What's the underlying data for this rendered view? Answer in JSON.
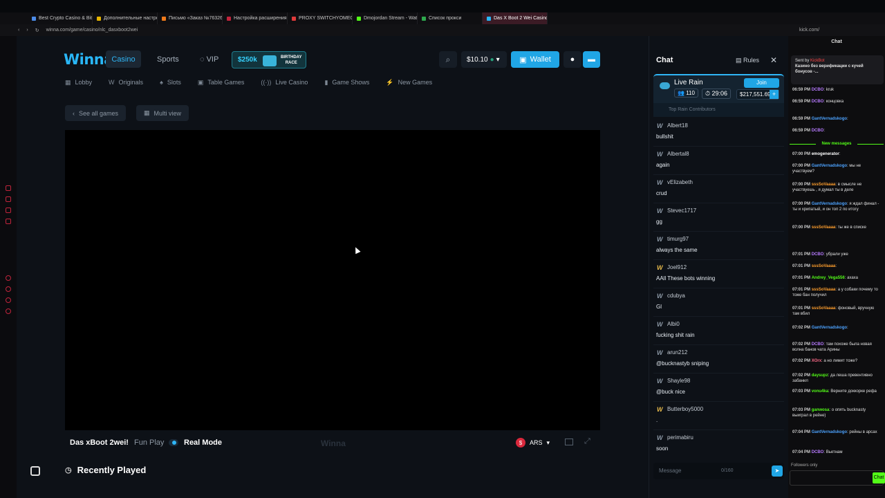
{
  "browser": {
    "tabs": [
      {
        "label": "Best Crypto Casino & Bitco",
        "color": "#4b8be8"
      },
      {
        "label": "Дополнительные настро",
        "color": "#e5b400"
      },
      {
        "label": "Письмо «Заказ №76326»",
        "color": "#f07a1a"
      },
      {
        "label": "Настройка расширения",
        "color": "#c2243c"
      },
      {
        "label": "PROXY SWITCHYOMEGA",
        "color": "#e03a3a"
      },
      {
        "label": "Dmojordan Stream - Watc",
        "color": "#53fc18"
      },
      {
        "label": "Список прокси",
        "color": "#2ea84d"
      },
      {
        "label": "Das X Boot 2 Wei Casino",
        "color": "#29b6f6",
        "active": true
      }
    ],
    "url": "winna.com/game/casino/nlc_dasxboot2wei",
    "url2": "kick.com/"
  },
  "site": {
    "logo": "Winna",
    "nav": {
      "casino": "Casino",
      "sports": "Sports",
      "vip": "VIP"
    },
    "race": {
      "amount": "$250k",
      "label_line1": "BIRTHDAY",
      "label_line2": "RACE"
    },
    "balance": "$10.10",
    "wallet": "Wallet",
    "subnav": [
      "Lobby",
      "Originals",
      "Slots",
      "Table Games",
      "Live Casino",
      "Game Shows",
      "New Games"
    ],
    "see_all": "See all games",
    "multi_view": "Multi view",
    "game_title": "Das xBoot 2wei!",
    "fun_play": "Fun Play",
    "real_mode": "Real Mode",
    "watermark": "Winna",
    "currency": "ARS",
    "recently_played": "Recently Played"
  },
  "chat": {
    "title": "Chat",
    "rules": "Rules",
    "rain": {
      "title": "Live Rain",
      "join": "Join",
      "users": "110",
      "timer": "29:06",
      "pot": "$217,551.69"
    },
    "contributors": "Top Rain Contributors",
    "messages": [
      {
        "user": "Albert18",
        "text": "bullshit"
      },
      {
        "user": "Albertal8",
        "text": "again"
      },
      {
        "user": "vElizabeth",
        "text": "crud"
      },
      {
        "user": "Stevec1717",
        "text": "gg"
      },
      {
        "user": "timurg97",
        "text": "always the same"
      },
      {
        "user": "Joel912",
        "text": "AAll These bots winning"
      },
      {
        "user": "cdubya",
        "text": "Gl"
      },
      {
        "user": "Albi0",
        "text": "fucking shit rain"
      },
      {
        "user": "arun212",
        "text": "@bucknastyb sniping"
      },
      {
        "user": "Shayle98",
        "text": "@buck nice"
      },
      {
        "user": "Butterboy5000",
        "text": "."
      },
      {
        "user": "perimabiru",
        "text": "soon"
      }
    ],
    "input_placeholder": "Message",
    "count": "0/160"
  },
  "kick": {
    "title": "Chat",
    "pinned_by": "Sent by",
    "pinned_name": "KickBot",
    "pinned_text": "Казино без верификации с кучей бонусов -...",
    "new_messages": "New messages",
    "followers": "Followers only",
    "chat_btn": "Chat",
    "lines": [
      {
        "time": "06:59 PM",
        "name": "DCBO",
        "color": "#b77bff",
        "text": "kruk"
      },
      {
        "time": "06:59 PM",
        "name": "DCBO",
        "color": "#b77bff",
        "text": "концовка"
      },
      {
        "time": "06:59 PM",
        "name": "GantVernadskogo",
        "color": "#4da3ff",
        "text": ""
      },
      {
        "time": "06:59 PM",
        "name": "DCBO",
        "color": "#b77bff",
        "text": ""
      },
      {
        "time": "07:00 PM",
        "name": "emogenerator",
        "color": "#ffffff",
        "text": ""
      },
      {
        "time": "07:00 PM",
        "name": "GantVernadskogo",
        "color": "#4da3ff",
        "text": "мы не участвуем?"
      },
      {
        "time": "07:00 PM",
        "name": "sssSoVaaaa",
        "color": "#ff9f2e",
        "text": "в смысле не участвуешь , я думал ты в деле"
      },
      {
        "time": "07:00 PM",
        "name": "GantVernadskogo",
        "color": "#4da3ff",
        "text": "я ждал финал - ты и хрипатый, и он топ 2 по итогу"
      },
      {
        "time": "07:00 PM",
        "name": "sssSoVaaaa",
        "color": "#ff9f2e",
        "text": "ты же в списке"
      },
      {
        "time": "07:01 PM",
        "name": "DCBO",
        "color": "#b77bff",
        "text": "убрали уже"
      },
      {
        "time": "07:01 PM",
        "name": "sssSoVaaaa",
        "color": "#ff9f2e",
        "text": ""
      },
      {
        "time": "07:01 PM",
        "name": "Andrey_Vega556",
        "color": "#53fc18",
        "text": "ахаха"
      },
      {
        "time": "07:01 PM",
        "name": "sssSoVaaaa",
        "color": "#ff9f2e",
        "text": "а у собаки почему то тоже бан получил"
      },
      {
        "time": "07:01 PM",
        "name": "sssSoVaaaa",
        "color": "#ff9f2e",
        "text": "фоновый, вручную там вбил"
      },
      {
        "time": "07:02 PM",
        "name": "GantVernadskogo",
        "color": "#4da3ff",
        "text": ""
      },
      {
        "time": "07:02 PM",
        "name": "DCBO",
        "color": "#b77bff",
        "text": "там похоже была новая волна банов чата Арины"
      },
      {
        "time": "07:02 PM",
        "name": "XOrx",
        "color": "#ff6b8a",
        "text": "а но лимит тоже?"
      },
      {
        "time": "07:02 PM",
        "name": "daysupz",
        "color": "#53fc18",
        "text": "да леша превентивно забанил"
      },
      {
        "time": "07:03 PM",
        "name": "vonu4ka",
        "color": "#53fc18",
        "text": "Верните доккорке рефа"
      },
      {
        "time": "07:03 PM",
        "name": "ganwosa",
        "color": "#53fc18",
        "text": "о опять bucknasty выиграл в рейне)"
      },
      {
        "time": "07:04 PM",
        "name": "GantVernadskogo",
        "color": "#4da3ff",
        "text": "рейны в арсах"
      },
      {
        "time": "07:04 PM",
        "name": "DCBO",
        "color": "#b77bff",
        "text": "Вьетнам"
      }
    ]
  },
  "accent": "#20a6e6"
}
